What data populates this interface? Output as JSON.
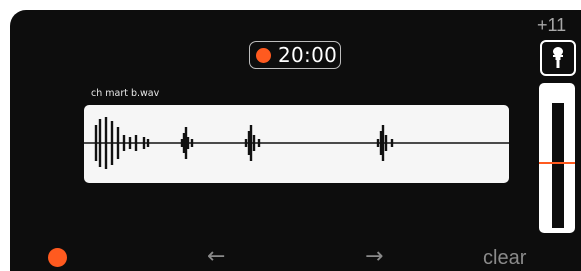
{
  "recorder": {
    "timer": "20:00",
    "filename": "ch mart b.wav",
    "gain": "+11",
    "level": 0.53,
    "colors": {
      "accent": "#ff5a1f",
      "background": "#0d0d0d",
      "wave_bg": "#f6f6f6",
      "muted": "#8a8a8a"
    }
  },
  "controls": {
    "back_label": "←",
    "forward_label": "→",
    "clear_label": "clear",
    "record_icon": "record-dot-icon",
    "mic_icon": "microphone-icon"
  }
}
